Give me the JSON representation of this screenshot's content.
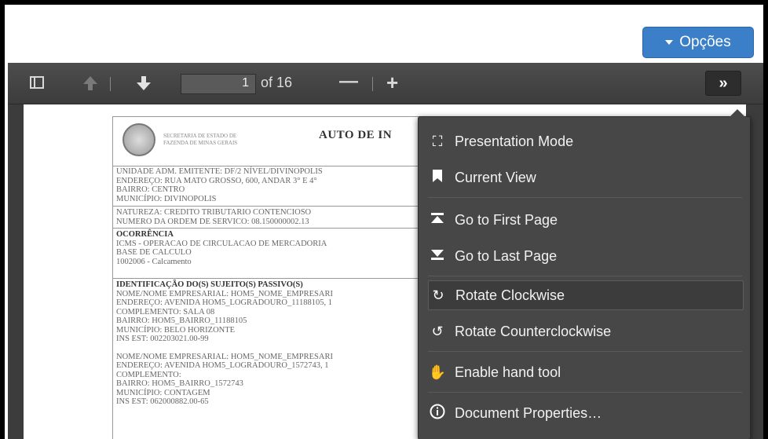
{
  "header": {
    "options_label": "Opções"
  },
  "toolbar": {
    "page_number": "1",
    "page_total": "of 16",
    "zoom_out": "—",
    "zoom_in": "+",
    "tools_toggle": "»"
  },
  "tools_menu": {
    "items": [
      {
        "label": "Presentation Mode",
        "icon": "presentation-icon"
      },
      {
        "label": "Current View",
        "icon": "bookmark-icon"
      },
      {
        "label": "Go to First Page",
        "icon": "first-page-icon"
      },
      {
        "label": "Go to Last Page",
        "icon": "last-page-icon"
      },
      {
        "label": "Rotate Clockwise",
        "icon": "rotate-cw-icon"
      },
      {
        "label": "Rotate Counterclockwise",
        "icon": "rotate-ccw-icon"
      },
      {
        "label": "Enable hand tool",
        "icon": "hand-icon"
      },
      {
        "label": "Document Properties…",
        "icon": "info-icon"
      }
    ]
  },
  "document": {
    "secretaria": [
      "SECRETARIA DE ESTADO DE",
      "FAZENDA DE MINAS GERAIS"
    ],
    "title": "AUTO DE IN",
    "block1": [
      "UNIDADE ADM. EMITENTE: DF/2 NÍVEL/DIVINOPOLIS",
      "ENDEREÇO: RUA MATO GROSSO, 600, ANDAR 3° E 4°",
      "BAIRRO: CENTRO",
      "MUNICÍPIO: DIVINOPOLIS"
    ],
    "block2": [
      "NATUREZA: CREDITO TRIBUTARIO CONTENCIOSO",
      "NUMERO DA ORDEM DE SERVICO: 08.150000002.13"
    ],
    "block3_title": "OCORRÊNCIA",
    "block3": [
      "ICMS - OPERACAO DE CIRCULACAO DE MERCADORIA",
      "BASE DE CALCULO",
      "1002006 - Calcamento"
    ],
    "block4_title": "IDENTIFICAÇÃO DO(S) SUJEITO(S) PASSIVO(S)",
    "block4": [
      "NOME/NOME EMPRESARIAL: HOM5_NOME_EMPRESARI",
      "ENDEREÇO: AVENIDA HOM5_LOGRADOURO_11188105, 1",
      "COMPLEMENTO: SALA 08",
      "BAIRRO: HOM5_BAIRRO_11188105",
      "MUNICÍPIO: BELO HORIZONTE",
      "INS EST: 002203021.00-99",
      "",
      "NOME/NOME EMPRESARIAL: HOM5_NOME_EMPRESARI",
      "ENDEREÇO: AVENIDA HOM5_LOGRADOURO_1572743, 1",
      "COMPLEMENTO:",
      "BAIRRO: HOM5_BAIRRO_1572743",
      "MUNICÍPIO: CONTAGEM",
      "INS EST: 062000882.00-65"
    ]
  }
}
